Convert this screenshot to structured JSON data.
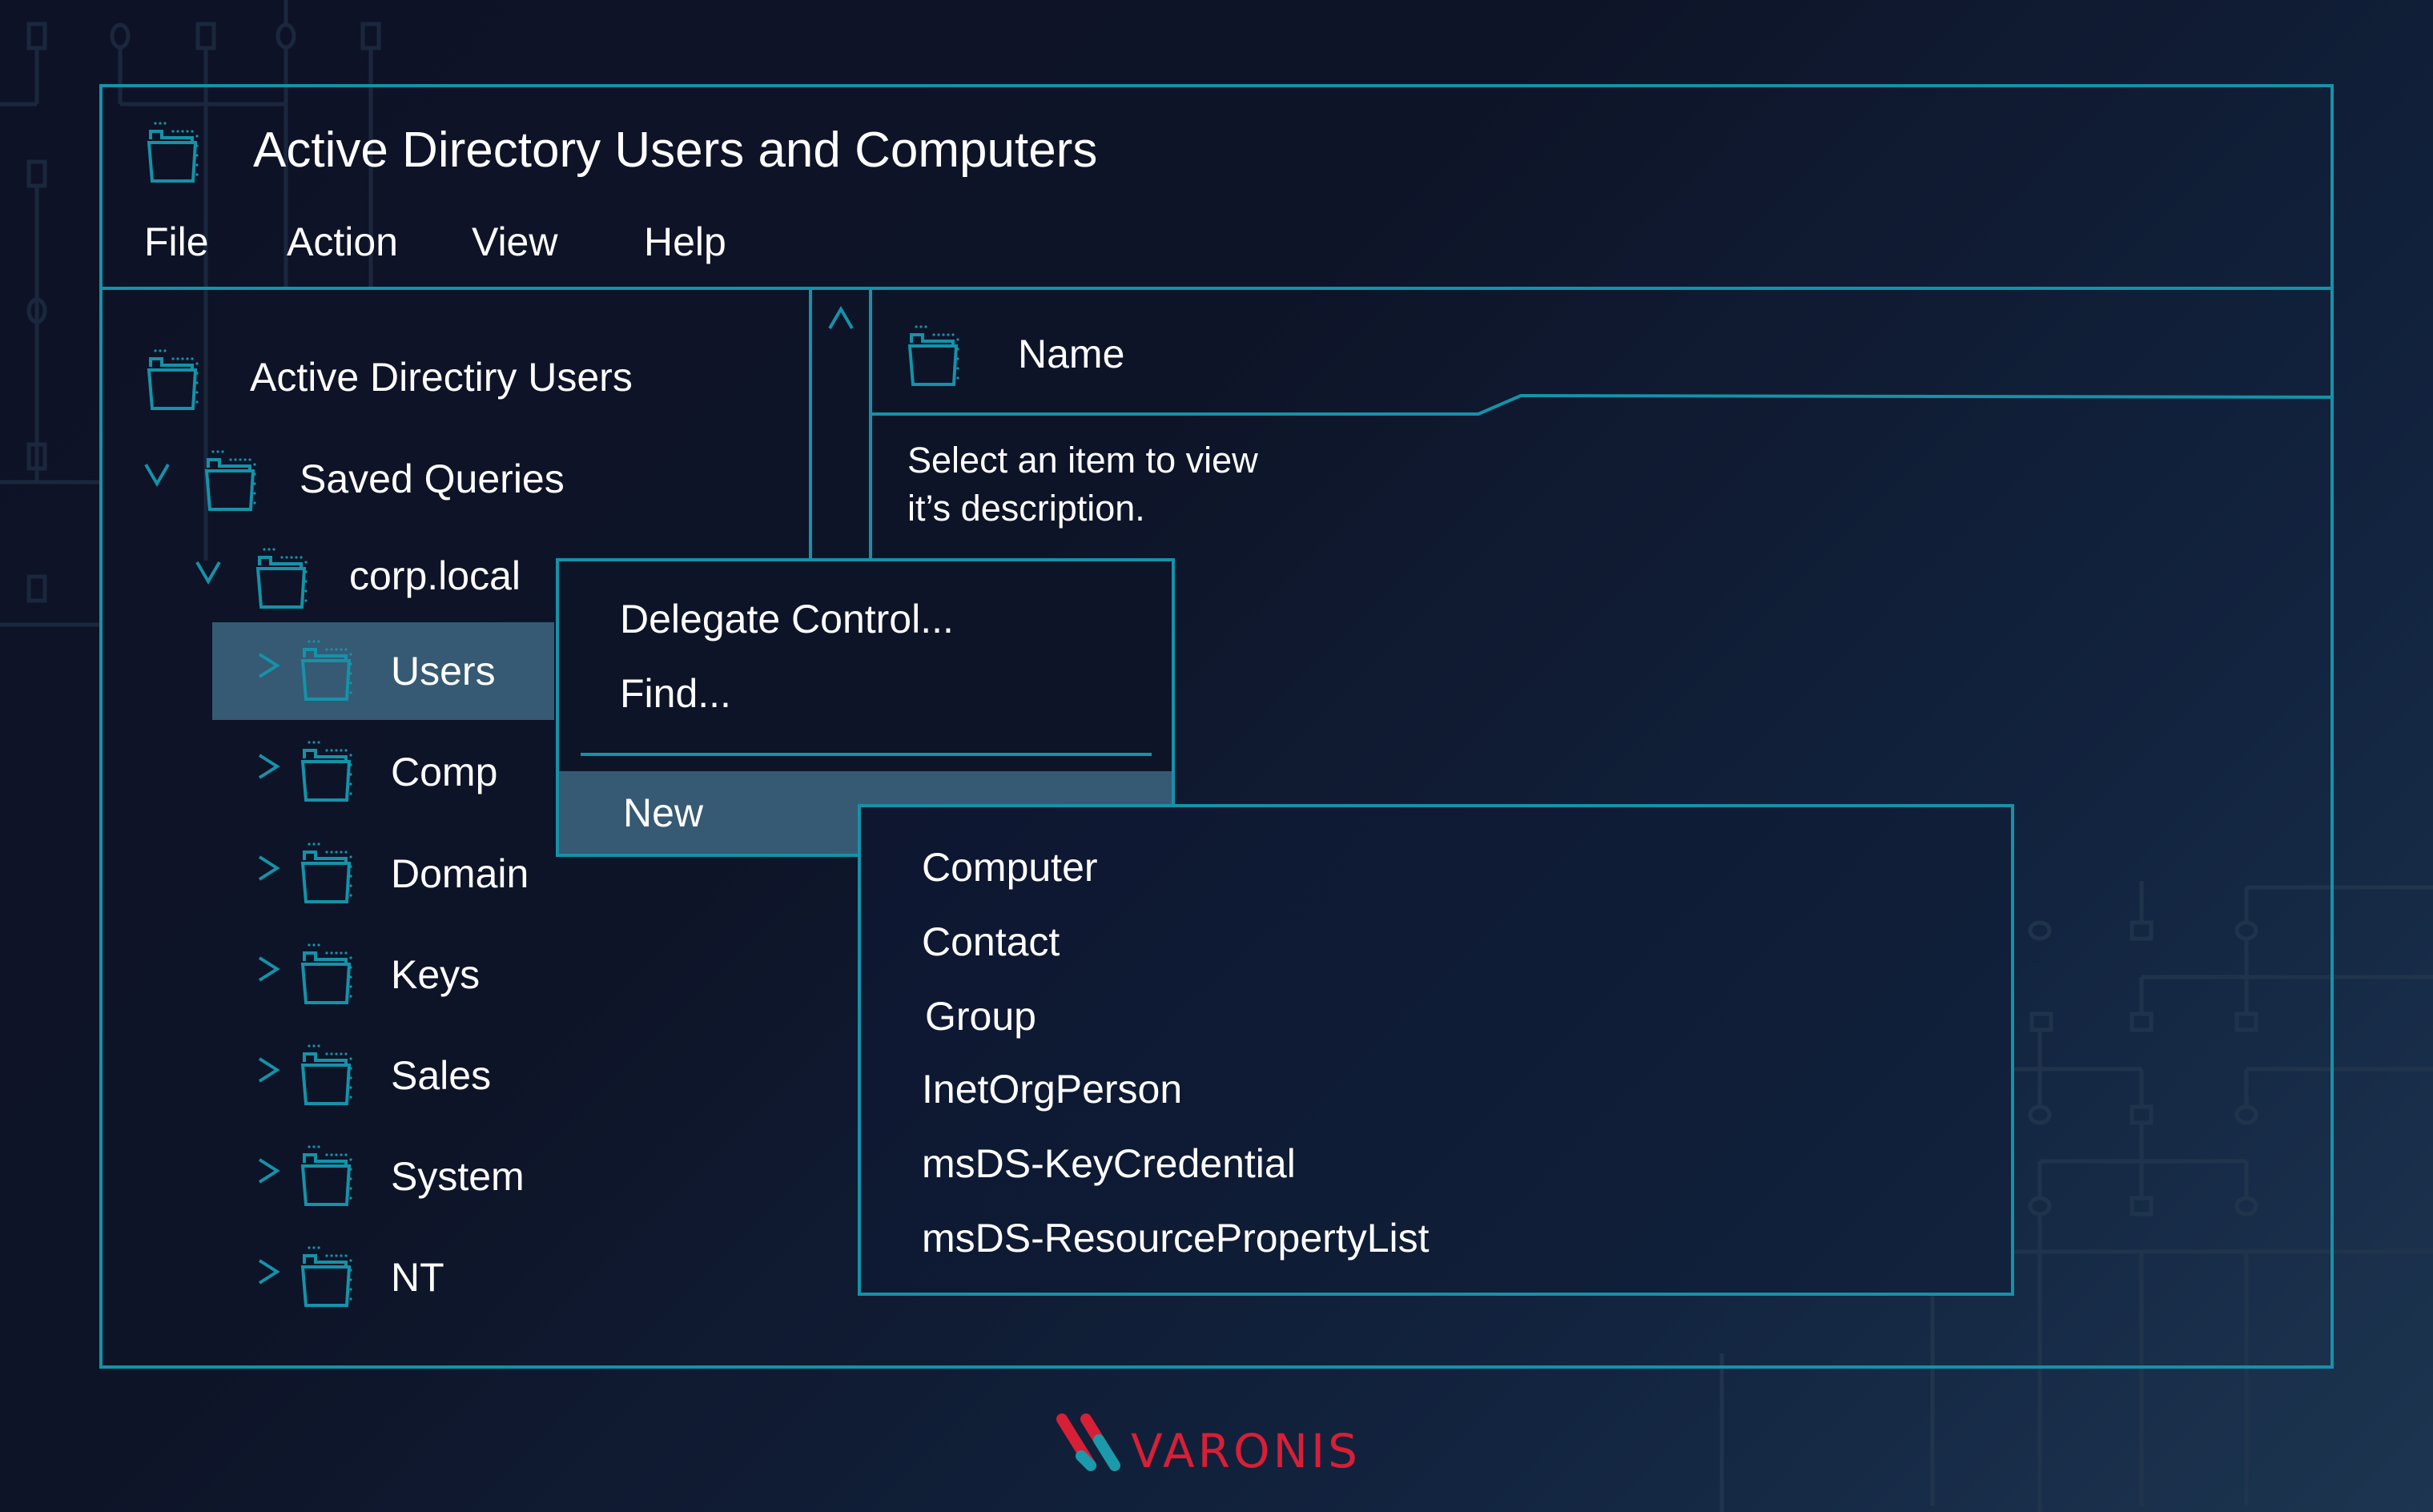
{
  "window": {
    "title": "Active Directory Users and Computers",
    "title_icon": "folder-icon"
  },
  "menubar": {
    "items": [
      {
        "label": "File"
      },
      {
        "label": "Action"
      },
      {
        "label": "View"
      },
      {
        "label": "Help"
      }
    ]
  },
  "tree": {
    "scroll_up_icon": "chevron-up-icon",
    "root": {
      "label": "Active Directiry Users",
      "icon": "folder-icon"
    },
    "saved_queries": {
      "label": "Saved Queries",
      "expanded": true,
      "icon": "folder-icon"
    },
    "domain": {
      "label": "corp.local",
      "expanded": true,
      "icon": "folder-icon"
    },
    "children": [
      {
        "label": "Users",
        "selected": true
      },
      {
        "label": "Comp",
        "selected": false
      },
      {
        "label": "Domain",
        "selected": false
      },
      {
        "label": "Keys",
        "selected": false
      },
      {
        "label": "Sales",
        "selected": false
      },
      {
        "label": "System",
        "selected": false
      },
      {
        "label": "NT",
        "selected": false
      }
    ]
  },
  "details": {
    "column_header": "Name",
    "description_line1": "Select an item to view",
    "description_line2": "it’s description."
  },
  "context_menu": {
    "items": [
      {
        "label": "Delegate Control..."
      },
      {
        "label": "Find..."
      }
    ],
    "highlighted": {
      "label": "New"
    }
  },
  "submenu": {
    "items": [
      {
        "label": "Computer"
      },
      {
        "label": "Contact"
      },
      {
        "label": "Group"
      },
      {
        "label": "InetOrgPerson"
      },
      {
        "label": "msDS-KeyCredential"
      },
      {
        "label": "msDS-ResourcePropertyList"
      }
    ]
  },
  "brand": {
    "name": "VARONIS",
    "primary_color": "#d71f36",
    "secondary_color": "#1a9aaa"
  },
  "colors": {
    "accent": "#1592a8",
    "highlight": "#365a74",
    "background": "#0e1226",
    "text": "#ffffff"
  }
}
